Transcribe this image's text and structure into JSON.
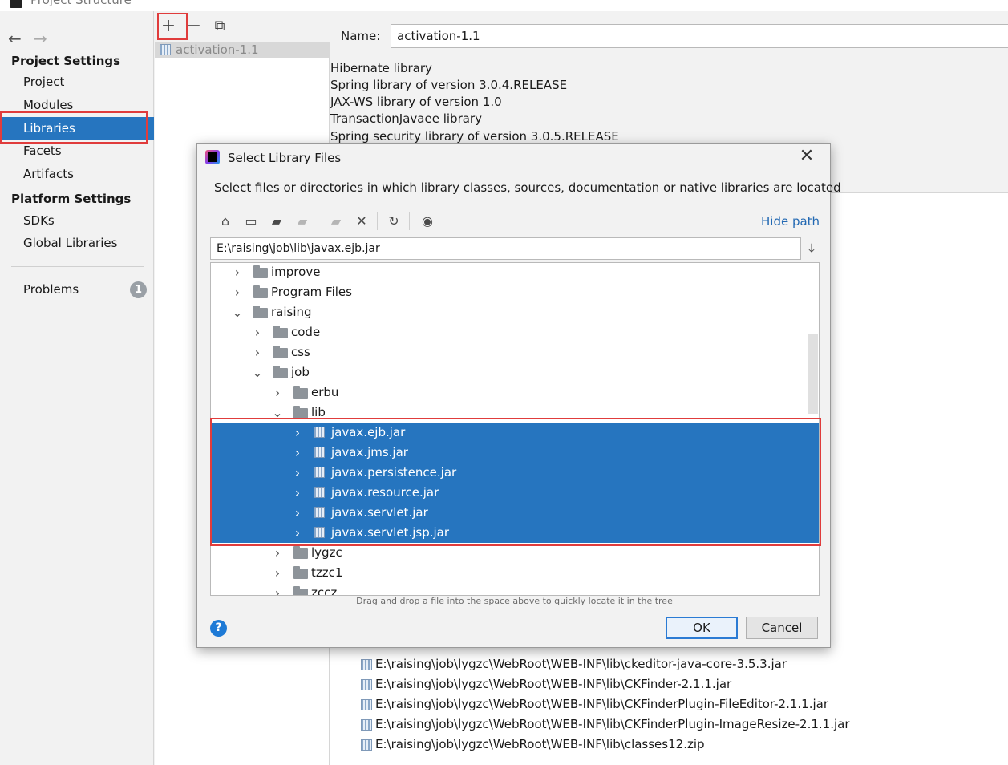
{
  "window": {
    "title": "Project Structure"
  },
  "sidebar": {
    "back_icon": "←",
    "forward_icon": "→",
    "project_settings_title": "Project Settings",
    "project_settings_items": [
      "Project",
      "Modules",
      "Libraries",
      "Facets",
      "Artifacts"
    ],
    "selected_item": "Libraries",
    "platform_settings_title": "Platform Settings",
    "platform_settings_items": [
      "SDKs",
      "Global Libraries"
    ],
    "problems_label": "Problems",
    "problems_count": "1"
  },
  "library_list": {
    "toolbar": {
      "add": "+",
      "remove": "−",
      "copy": "⧉"
    },
    "items": [
      "activation-1.1"
    ]
  },
  "library_details": {
    "name_label": "Name:",
    "name_value": "activation-1.1",
    "descriptions": [
      "Hibernate library",
      "Spring library of version 3.0.4.RELEASE",
      "JAX-WS library of version 1.0",
      "TransactionJavaee library",
      "Spring security library of version 3.0.5.RELEASE"
    ],
    "paths": [
      "E:\\raising\\job\\lygzc\\WebRoot\\WEB-INF\\lib\\ckeditor-java-core-3.5.3.jar",
      "E:\\raising\\job\\lygzc\\WebRoot\\WEB-INF\\lib\\CKFinder-2.1.1.jar",
      "E:\\raising\\job\\lygzc\\WebRoot\\WEB-INF\\lib\\CKFinderPlugin-FileEditor-2.1.1.jar",
      "E:\\raising\\job\\lygzc\\WebRoot\\WEB-INF\\lib\\CKFinderPlugin-ImageResize-2.1.1.jar",
      "E:\\raising\\job\\lygzc\\WebRoot\\WEB-INF\\lib\\classes12.zip"
    ]
  },
  "dialog": {
    "title": "Select Library Files",
    "close_icon": "✕",
    "description": "Select files or directories in which library classes, sources, documentation or native libraries are located",
    "hide_path": "Hide path",
    "path_value": "E:\\raising\\job\\lib\\javax.ejb.jar",
    "tree": [
      {
        "label": "improve",
        "type": "folder",
        "depth": 0,
        "expanded": false
      },
      {
        "label": "Program Files",
        "type": "folder",
        "depth": 0,
        "expanded": false
      },
      {
        "label": "raising",
        "type": "folder",
        "depth": 0,
        "expanded": true
      },
      {
        "label": "code",
        "type": "folder",
        "depth": 1,
        "expanded": false
      },
      {
        "label": "css",
        "type": "folder",
        "depth": 1,
        "expanded": false
      },
      {
        "label": "job",
        "type": "folder",
        "depth": 1,
        "expanded": true
      },
      {
        "label": "erbu",
        "type": "folder",
        "depth": 2,
        "expanded": false
      },
      {
        "label": "lib",
        "type": "folder",
        "depth": 2,
        "expanded": true
      },
      {
        "label": "javax.ejb.jar",
        "type": "jar",
        "depth": 3,
        "selected": true
      },
      {
        "label": "javax.jms.jar",
        "type": "jar",
        "depth": 3,
        "selected": true
      },
      {
        "label": "javax.persistence.jar",
        "type": "jar",
        "depth": 3,
        "selected": true
      },
      {
        "label": "javax.resource.jar",
        "type": "jar",
        "depth": 3,
        "selected": true
      },
      {
        "label": "javax.servlet.jar",
        "type": "jar",
        "depth": 3,
        "selected": true
      },
      {
        "label": "javax.servlet.jsp.jar",
        "type": "jar",
        "depth": 3,
        "selected": true
      },
      {
        "label": "lygzc",
        "type": "folder",
        "depth": 2,
        "expanded": false
      },
      {
        "label": "tzzc1",
        "type": "folder",
        "depth": 2,
        "expanded": false
      },
      {
        "label": "zccz",
        "type": "folder",
        "depth": 2,
        "expanded": false
      }
    ],
    "drag_hint": "Drag and drop a file into the space above to quickly locate it in the tree",
    "help": "?",
    "ok": "OK",
    "cancel": "Cancel"
  },
  "colors": {
    "selection": "#2675bf",
    "highlight_border": "#e03c3c",
    "link": "#2369b3"
  }
}
